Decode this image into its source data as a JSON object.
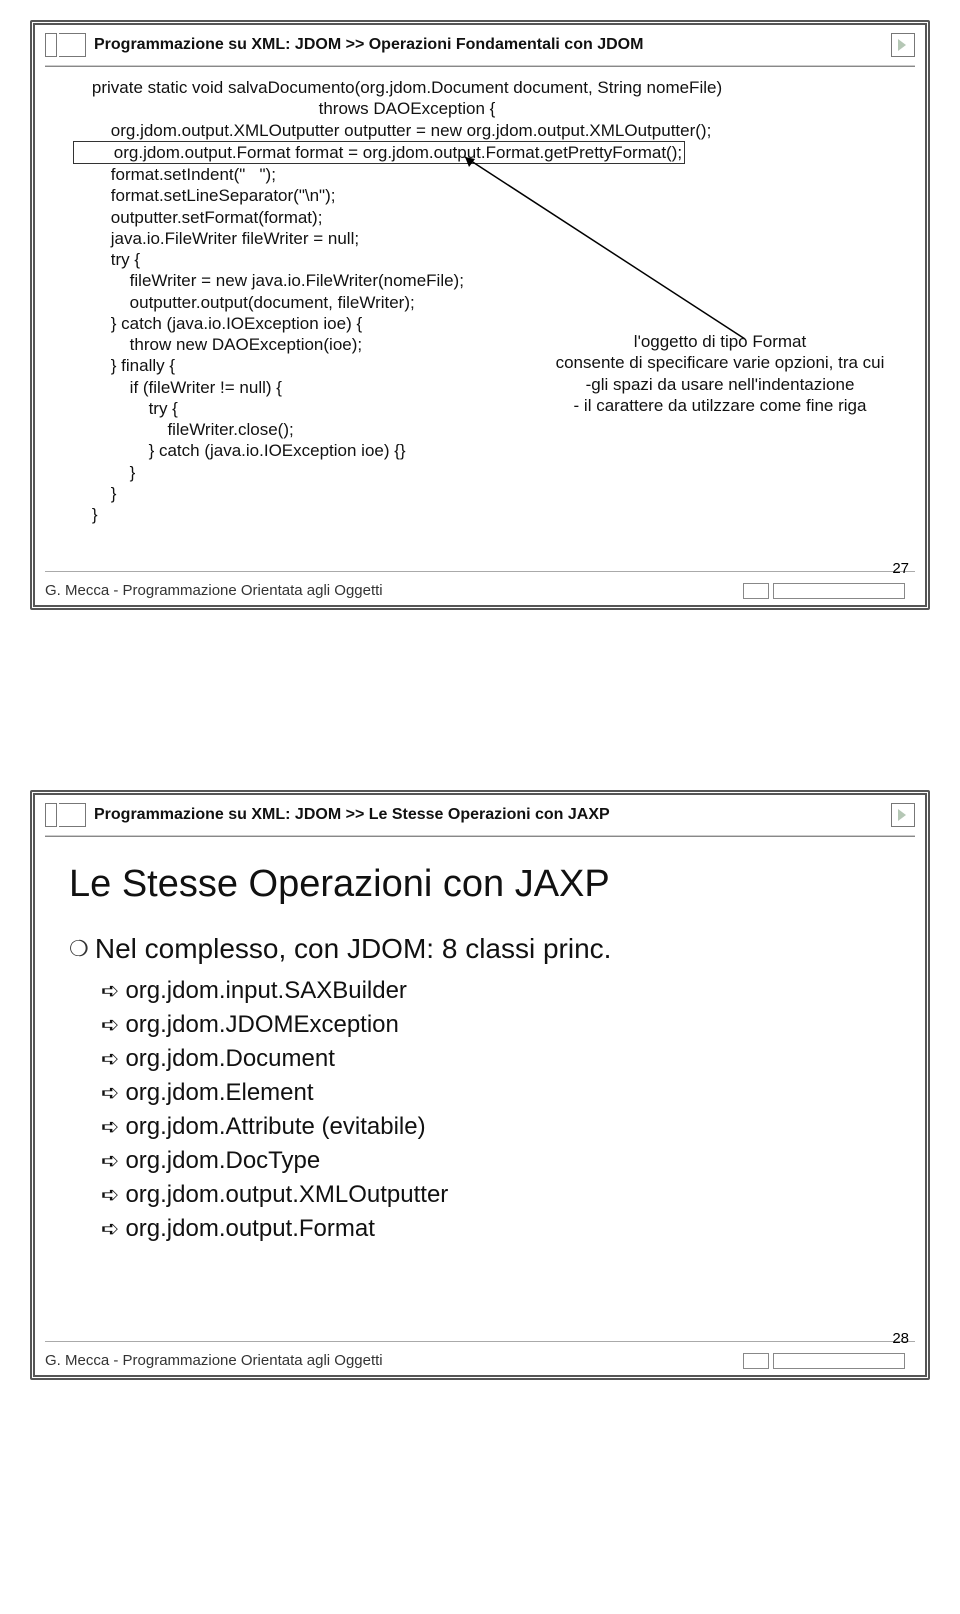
{
  "slide1": {
    "breadcrumb": "Programmazione su XML: JDOM >> Operazioni Fondamentali con JDOM",
    "code_before_box": "    private static void salvaDocumento(org.jdom.Document document, String nomeFile)\n                                                    throws DAOException {\n        org.jdom.output.XMLOutputter outputter = new org.jdom.output.XMLOutputter();",
    "code_boxed": "        org.jdom.output.Format format = org.jdom.output.Format.getPrettyFormat();",
    "code_after_box": "        format.setIndent(\"   \");\n        format.setLineSeparator(\"\\n\");\n        outputter.setFormat(format);\n        java.io.FileWriter fileWriter = null;\n        try {\n            fileWriter = new java.io.FileWriter(nomeFile);\n            outputter.output(document, fileWriter);\n        } catch (java.io.IOException ioe) {\n            throw new DAOException(ioe);\n        } finally {\n            if (fileWriter != null) {\n                try {\n                    fileWriter.close();\n                } catch (java.io.IOException ioe) {}\n            }\n        }\n    }",
    "annotation_l1": "l'oggetto di tipo Format",
    "annotation_l2": "consente di specificare varie opzioni, tra cui",
    "annotation_l3": "-gli spazi da usare nell'indentazione",
    "annotation_l4": "- il carattere da utilzzare come fine riga",
    "footer": "G. Mecca - Programmazione Orientata agli Oggetti",
    "pagenum": "27"
  },
  "slide2": {
    "breadcrumb": "Programmazione su XML: JDOM >> Le Stesse Operazioni con JAXP",
    "title": "Le Stesse Operazioni con JAXP",
    "main_bullet": "Nel complesso, con JDOM: 8 classi princ.",
    "subs": [
      "org.jdom.input.SAXBuilder",
      "org.jdom.JDOMException",
      "org.jdom.Document",
      "org.jdom.Element",
      "org.jdom.Attribute (evitabile)",
      "org.jdom.DocType",
      "org.jdom.output.XMLOutputter",
      "org.jdom.output.Format"
    ],
    "footer": "G. Mecca - Programmazione Orientata agli Oggetti",
    "pagenum": "28"
  }
}
